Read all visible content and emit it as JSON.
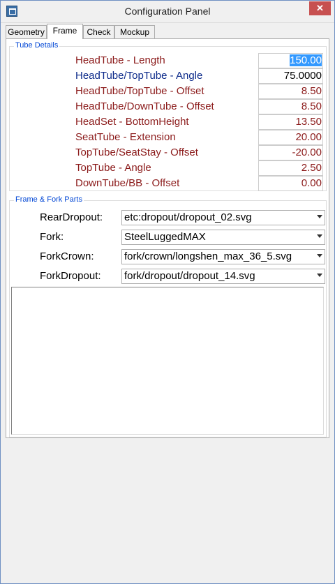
{
  "window": {
    "title": "Configuration Panel",
    "close_label": "✕"
  },
  "tabs": [
    {
      "label": "Geometry",
      "active": false
    },
    {
      "label": "Frame",
      "active": true
    },
    {
      "label": "Check",
      "active": false
    },
    {
      "label": "Mockup",
      "active": false
    }
  ],
  "tube_details": {
    "title": "Tube Details",
    "rows": [
      {
        "label": "HeadTube - Length",
        "value": "150.00",
        "selected": true
      },
      {
        "label": "HeadTube/TopTube - Angle",
        "value": "75.0000"
      },
      {
        "label": "HeadTube/TopTube - Offset",
        "value": "8.50"
      },
      {
        "label": "HeadTube/DownTube - Offset",
        "value": "8.50"
      },
      {
        "label": "HeadSet - BottomHeight",
        "value": "13.50"
      },
      {
        "label": "SeatTube - Extension",
        "value": "20.00"
      },
      {
        "label": "TopTube/SeatStay - Offset",
        "value": "-20.00"
      },
      {
        "label": "TopTube - Angle",
        "value": "2.50"
      },
      {
        "label": "DownTube/BB - Offset",
        "value": "0.00"
      }
    ]
  },
  "frame_fork_parts": {
    "title": "Frame & Fork Parts",
    "rows": [
      {
        "label": "RearDropout:",
        "value": "etc:dropout/dropout_02.svg"
      },
      {
        "label": "Fork:",
        "value": "SteelLuggedMAX"
      },
      {
        "label": "ForkCrown:",
        "value": "fork/crown/longshen_max_36_5.svg"
      },
      {
        "label": "ForkDropout:",
        "value": "fork/dropout/dropout_14.svg"
      }
    ]
  },
  "colors": {
    "label_red": "#8b1a1a",
    "label_blue": "#0c2a8a",
    "group_title": "#0046d5",
    "selection": "#3399ff"
  }
}
